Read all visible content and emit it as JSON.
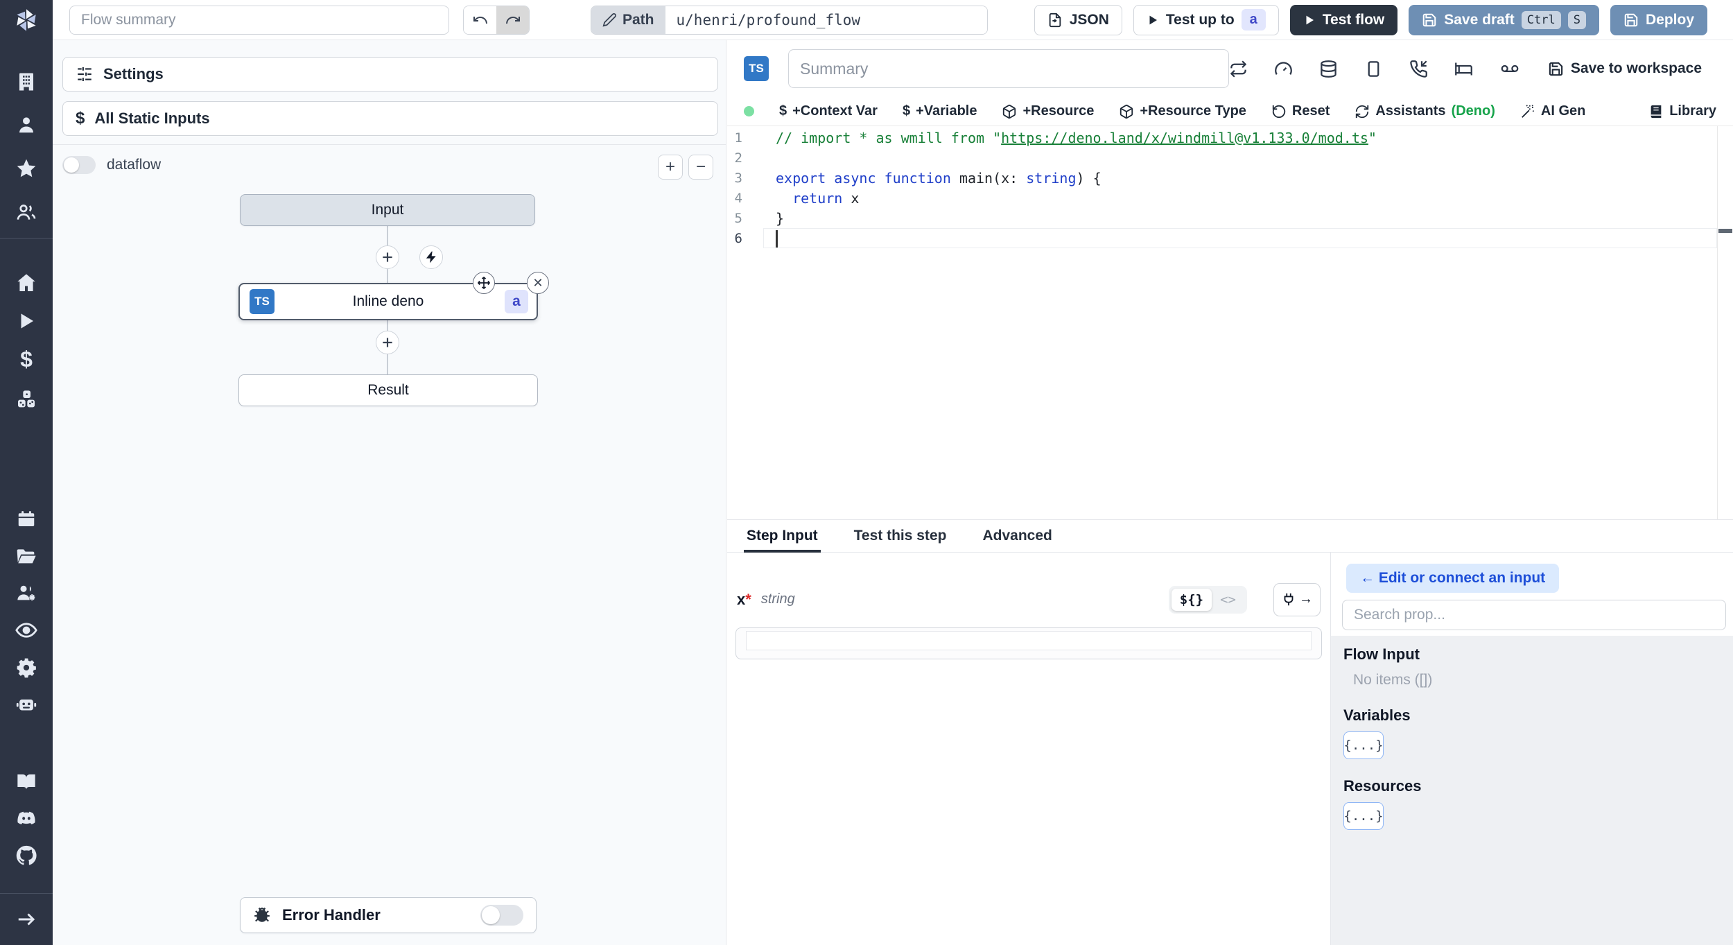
{
  "topbar": {
    "flow_summary_placeholder": "Flow summary",
    "path_label": "Path",
    "path_value": "u/henri/profound_flow",
    "json_button": "JSON",
    "test_up_to": "Test up to",
    "test_up_to_badge": "a",
    "test_flow": "Test flow",
    "save_draft": "Save draft",
    "kbd": [
      "Ctrl",
      "S"
    ],
    "deploy": "Deploy"
  },
  "flow_panel": {
    "settings": "Settings",
    "all_static_inputs": "All Static Inputs",
    "dataflow": "dataflow",
    "zoom_in": "+",
    "zoom_out": "−"
  },
  "graph": {
    "input": "Input",
    "step_lang": "TS",
    "step_label": "Inline deno",
    "step_badge": "a",
    "close_glyph": "✕",
    "plus_glyph": "+",
    "result": "Result",
    "error_handler": "Error Handler"
  },
  "editor": {
    "lang_badge": "TS",
    "summary_placeholder": "Summary",
    "save_to_workspace": "Save to workspace",
    "toolbar": {
      "dollar": "$",
      "context_var": "+Context Var",
      "variable": "+Variable",
      "resource": "+Resource",
      "resource_type": "+Resource Type",
      "reset": "Reset",
      "assistants": "Assistants",
      "assistants_lang": "(Deno)",
      "ai_gen": "AI Gen",
      "library": "Library"
    },
    "code": [
      {
        "n": "1",
        "tokens": [
          {
            "t": "// import * as wmill from \"",
            "c": "cm"
          },
          {
            "t": "https://deno.land/x/windmill@v1.133.0/mod.ts",
            "c": "cm lnk"
          },
          {
            "t": "\"",
            "c": "cm"
          }
        ]
      },
      {
        "n": "2",
        "tokens": []
      },
      {
        "n": "3",
        "tokens": [
          {
            "t": "export",
            "c": "kw"
          },
          {
            "t": " ",
            "c": "pl"
          },
          {
            "t": "async",
            "c": "kw"
          },
          {
            "t": " ",
            "c": "pl"
          },
          {
            "t": "function",
            "c": "kw"
          },
          {
            "t": " main(x: ",
            "c": "pl"
          },
          {
            "t": "string",
            "c": "kw"
          },
          {
            "t": ") {",
            "c": "pl"
          }
        ]
      },
      {
        "n": "4",
        "tokens": [
          {
            "t": "  ",
            "c": "pl"
          },
          {
            "t": "return",
            "c": "kw"
          },
          {
            "t": " x",
            "c": "pl"
          }
        ]
      },
      {
        "n": "5",
        "tokens": [
          {
            "t": "}",
            "c": "pl"
          }
        ]
      },
      {
        "n": "6",
        "tokens": [],
        "cursor": true
      }
    ]
  },
  "tabs": [
    {
      "label": "Step Input"
    },
    {
      "label": "Test this step"
    },
    {
      "label": "Advanced"
    }
  ],
  "step_input": {
    "name": "x",
    "required": "*",
    "type": "string",
    "expr_toggle": "${}",
    "code_toggle": "<>",
    "arrow": "→"
  },
  "connect": {
    "back": "← Edit or connect an input",
    "search_placeholder": "Search prop...",
    "flow_input_title": "Flow Input",
    "flow_input_empty": "No items ([])",
    "variables_title": "Variables",
    "variables_button": "{...}",
    "resources_title": "Resources",
    "resources_button": "{...}"
  },
  "colors": {
    "rail_bg": "#2d3444",
    "primary_button": "#6e8fb4",
    "dark_button": "#2b3440",
    "badge_bg": "#dfe3fc",
    "badge_text": "#4049c8",
    "connect_button_bg": "#dbeafe",
    "connect_button_text": "#1d4ed8",
    "status_dot": "#7ce0a3",
    "deno_green": "#16a34a",
    "code_keyword": "#2140c9",
    "code_comment": "#188038",
    "ts_badge": "#3178c6"
  },
  "rail_icons": [
    "windmill-logo",
    "building",
    "user",
    "star",
    "team",
    "home",
    "play",
    "dollar",
    "cubes",
    "calendar",
    "folder-open",
    "users-gear",
    "eye",
    "gear",
    "robot",
    "book-open",
    "discord",
    "github",
    "arrow-right"
  ]
}
